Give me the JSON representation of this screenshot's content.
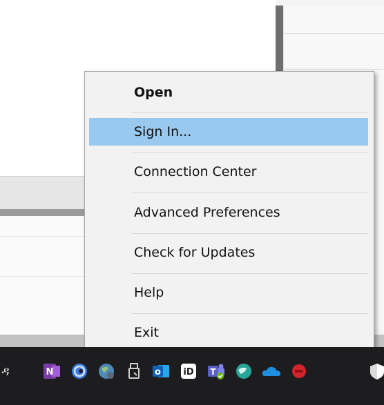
{
  "context_menu": {
    "items": [
      {
        "label": "Open"
      },
      {
        "label": "Sign In..."
      },
      {
        "label": "Connection Center"
      },
      {
        "label": "Advanced Preferences"
      },
      {
        "label": "Check for Updates"
      },
      {
        "label": "Help"
      },
      {
        "label": "Exit"
      }
    ],
    "highlight_color": "#99c9ef"
  },
  "taskbar": {
    "partial_glyph": "ዳ",
    "icons": [
      {
        "name": "onenote-icon",
        "letter": "N",
        "color": "#7b3ba8"
      },
      {
        "name": "edge-dev-icon",
        "letter": "",
        "color": "#3f7de3"
      },
      {
        "name": "globe-icon",
        "letter": "",
        "color": "#4e8ab5"
      },
      {
        "name": "usb-drive-icon",
        "letter": "",
        "color": "#cfcfcf"
      },
      {
        "name": "outlook-icon",
        "letter": "o",
        "color": "#1a6fc6"
      },
      {
        "name": "id-app-icon",
        "letter": "iD",
        "color": "#ffffff"
      },
      {
        "name": "teams-icon",
        "letter": "T",
        "color": "#5b5fc7"
      },
      {
        "name": "network-globe-icon",
        "letter": "",
        "color": "#26a79a"
      },
      {
        "name": "onedrive-cloud-icon",
        "letter": "",
        "color": "#1e8fe0"
      },
      {
        "name": "red-app-icon",
        "letter": "",
        "color": "#d3242c"
      },
      {
        "name": "security-shield-icon",
        "letter": "",
        "color": "#ffffff"
      }
    ]
  }
}
